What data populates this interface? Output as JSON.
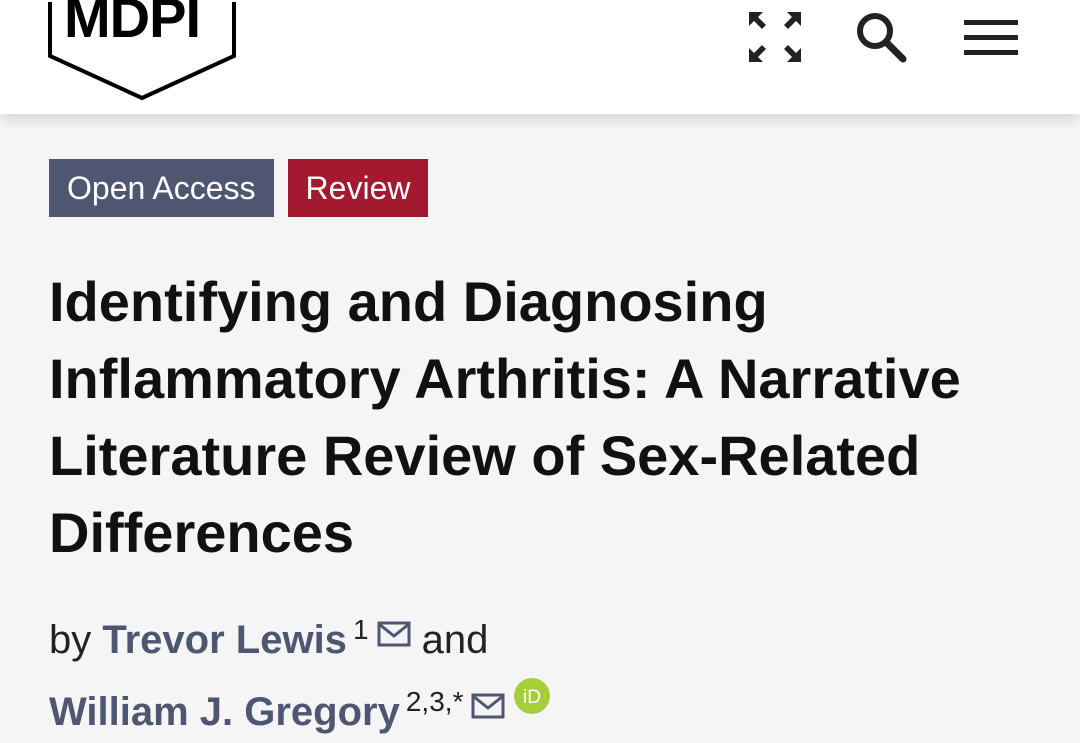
{
  "header": {
    "logo_text": "MDPI",
    "icons": [
      "expand-icon",
      "search-icon",
      "hamburger-menu-icon"
    ]
  },
  "article": {
    "badges": {
      "access": "Open Access",
      "type": "Review"
    },
    "title": "Identifying and Diagnosing Inflammatory Arthritis: A Narrative Literature Review of Sex-Related Differences",
    "byline": {
      "by": "by",
      "and": "and",
      "authors": [
        {
          "name": "Trevor Lewis",
          "affiliations": "1"
        },
        {
          "name": "William J. Gregory",
          "affiliations": "2,3,*"
        }
      ]
    }
  },
  "colors": {
    "badge_open_access": "#4f5671",
    "badge_review": "#a3192f",
    "author_link": "#4f5671",
    "orcid": "#a6ce39"
  }
}
